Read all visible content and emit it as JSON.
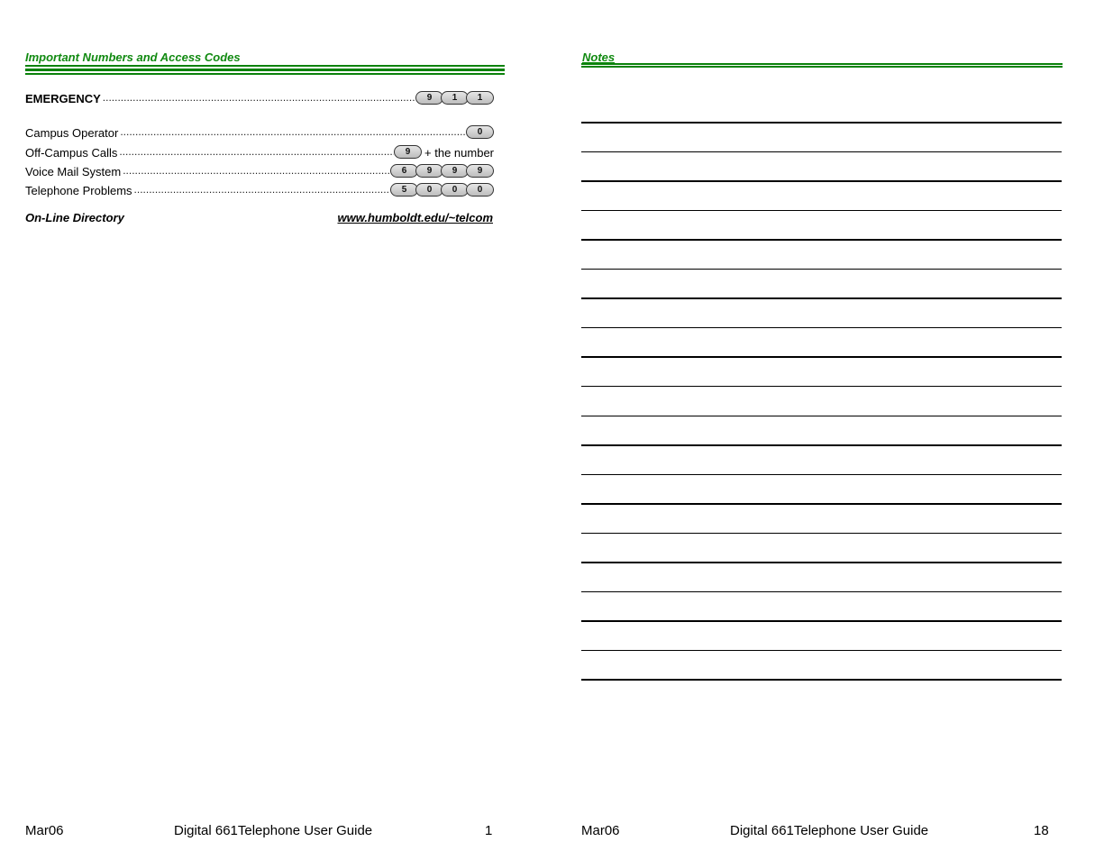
{
  "left_page": {
    "title": "Important Numbers and Access Codes",
    "entries": [
      {
        "label": "EMERGENCY",
        "keys": [
          "9",
          "1",
          "1"
        ],
        "suffix": ""
      },
      {
        "label": "Campus Operator",
        "keys": [
          "0"
        ],
        "suffix": ""
      },
      {
        "label": "Off-Campus Calls",
        "keys": [
          "9"
        ],
        "suffix": "+ the number"
      },
      {
        "label": "Voice Mail System",
        "keys": [
          "6",
          "9",
          "9",
          "9"
        ],
        "suffix": ""
      },
      {
        "label": "Telephone Problems",
        "keys": [
          "5",
          "0",
          "0",
          "0"
        ],
        "suffix": ""
      }
    ],
    "directory": {
      "label": "On-Line Directory",
      "link": "www.humboldt.edu/~telcom"
    },
    "footer": {
      "date": "Mar06",
      "guide_title": "Digital 661Telephone User Guide",
      "page_number": "1"
    }
  },
  "right_page": {
    "title": "Notes",
    "note_line_count": 20,
    "footer": {
      "date": "Mar06",
      "guide_title": "Digital 661Telephone User Guide",
      "page_number": "18"
    }
  },
  "colors": {
    "heading_green": "#118a11",
    "rule_green": "#0a820a"
  }
}
